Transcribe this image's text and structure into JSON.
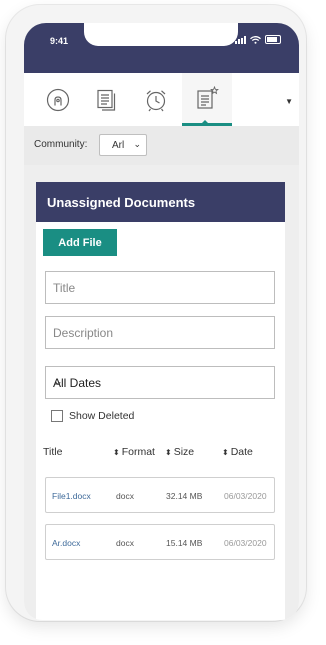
{
  "status": {
    "time": "9:41"
  },
  "tabs": [
    {
      "icon": "user-circle-icon"
    },
    {
      "icon": "documents-icon"
    },
    {
      "icon": "alarm-clock-icon"
    },
    {
      "icon": "document-star-icon",
      "active": true
    }
  ],
  "tab_dropdown": {
    "icon": "caret-down-icon"
  },
  "community": {
    "label": "Community:",
    "value": "Arl"
  },
  "panel": {
    "title": "Unassigned Documents",
    "add_file_label": "Add File",
    "title_placeholder": "Title",
    "description_placeholder": "Description",
    "date_filter": "All Dates",
    "show_deleted_label": "Show Deleted"
  },
  "table": {
    "headers": {
      "title": "Title",
      "format": "Format",
      "size": "Size",
      "date": "Date"
    },
    "rows": [
      {
        "title": "File1.docx",
        "format": "docx",
        "size": "32.14 MB",
        "date": "06/03/2020"
      },
      {
        "title": "Ar.docx",
        "format": "docx",
        "size": "15.14 MB",
        "date": "06/03/2020"
      }
    ]
  },
  "colors": {
    "header": "#3a3e67",
    "accent": "#1a8e83",
    "link": "#3e6a9a"
  }
}
